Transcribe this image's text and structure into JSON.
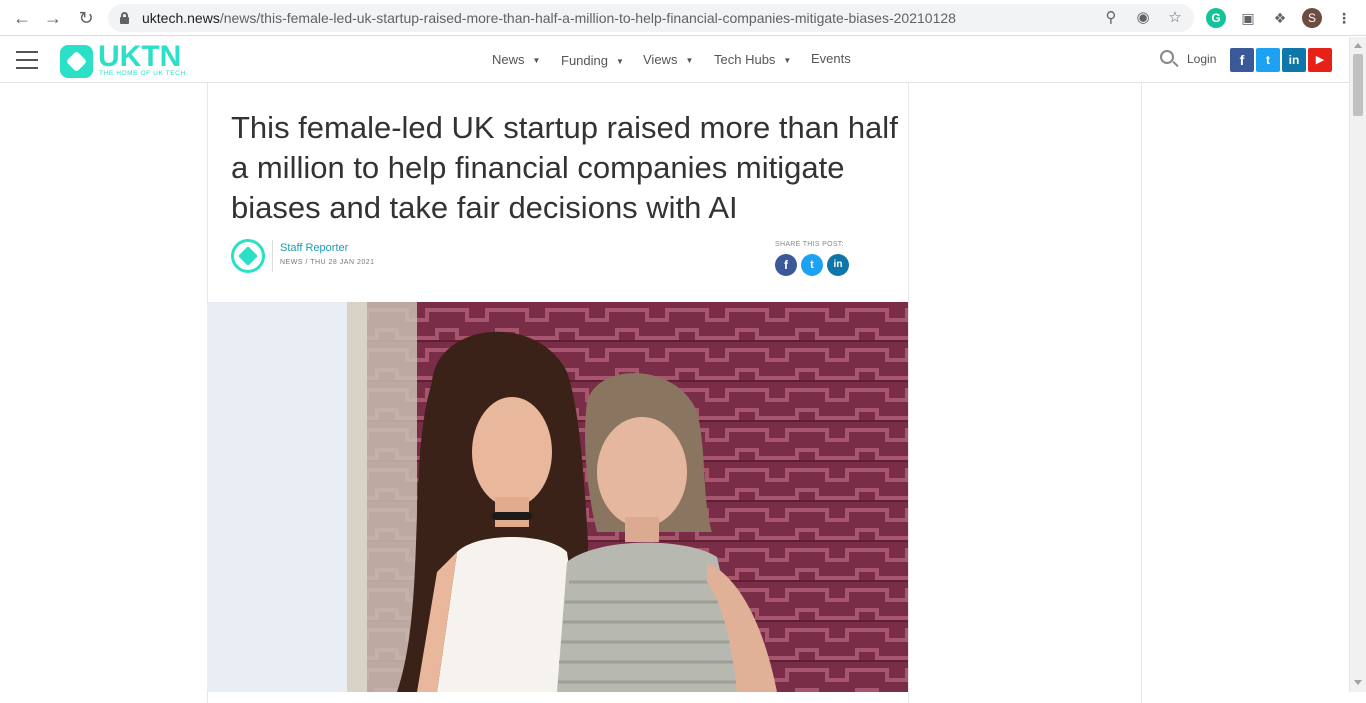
{
  "browser": {
    "url_domain": "uktech.news",
    "url_path": "/news/this-female-led-uk-startup-raised-more-than-half-a-million-to-help-financial-companies-mitigate-biases-20210128",
    "profile_initial": "S",
    "grammarly_letter": "G"
  },
  "site": {
    "logo_text": "UKTN",
    "logo_tagline": "THE HOME OF UK TECH",
    "nav": [
      "News",
      "Funding",
      "Views",
      "Tech Hubs",
      "Events"
    ],
    "login_label": "Login",
    "social": {
      "facebook": "f",
      "twitter": "t",
      "linkedin": "in",
      "youtube": "▶"
    }
  },
  "article": {
    "headline": "This female-led UK startup raised more than half a million to help financial companies mitigate biases and take fair decisions with AI",
    "author": "Staff Reporter",
    "meta": "NEWS / THU 28 JAN 2021",
    "share_label": "SHARE THIS POST:",
    "share": {
      "facebook": "f",
      "twitter": "t",
      "linkedin": "in"
    }
  },
  "colors": {
    "brand": "#2be0c6",
    "author_link": "#1c9bb5",
    "facebook": "#3b5998",
    "twitter": "#1da1f2",
    "linkedin": "#0e76a8",
    "youtube": "#e62117"
  }
}
